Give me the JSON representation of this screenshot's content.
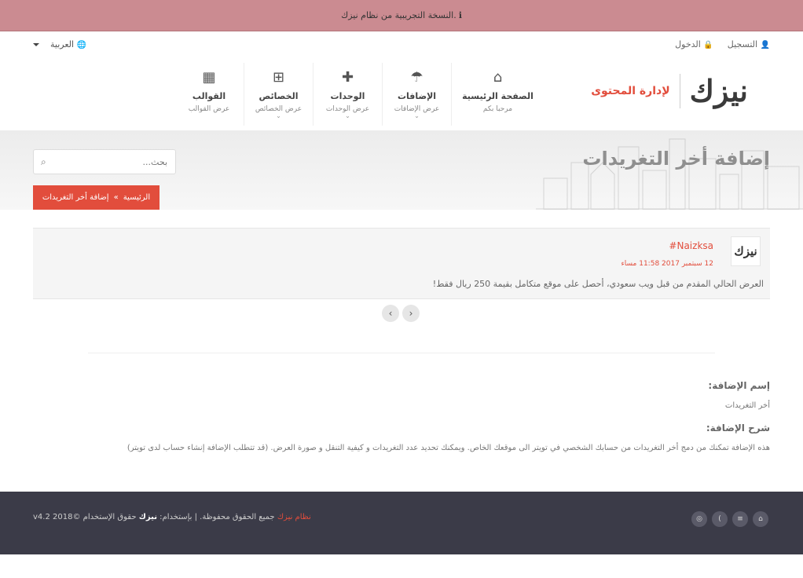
{
  "trial_bar": {
    "icon": "info-icon",
    "text": "النسخة التجريبية من نظام نيزك."
  },
  "topbar": {
    "register": "التسجيل",
    "login": "الدخول",
    "language": "العربية"
  },
  "logo": {
    "main": "نيزك",
    "sub": "لإدارة المحتوى"
  },
  "nav": [
    {
      "title": "الصفحة الرئيسية",
      "sub": "مرحبا بكم",
      "icon": "home-icon",
      "glyph": "⌂",
      "has_dropdown": false
    },
    {
      "title": "الإضافات",
      "sub": "عرض الإضافات",
      "icon": "umbrella-icon",
      "glyph": "☂",
      "has_dropdown": true
    },
    {
      "title": "الوحدات",
      "sub": "عرض الوحدات",
      "icon": "puzzle-icon",
      "glyph": "✚",
      "has_dropdown": true
    },
    {
      "title": "الخصائص",
      "sub": "عرض الخصائص",
      "icon": "sitemap-icon",
      "glyph": "⊞",
      "has_dropdown": true
    },
    {
      "title": "القوالب",
      "sub": "عرض القوالب",
      "icon": "qrcode-icon",
      "glyph": "▦",
      "has_dropdown": false
    }
  ],
  "banner": {
    "title": "إضافة أخر التغريدات",
    "search_placeholder": "بحث...",
    "breadcrumb_home": "الرئيسية",
    "breadcrumb_sep": "»",
    "breadcrumb_current": "إضافة أخر التغريدات"
  },
  "tweet": {
    "avatar": "نيزك",
    "user": "#Naizksa",
    "date": "12 سبتمبر 2017 11:58 مساء",
    "text": "العرض الحالي المقدم من قبل ويب سعودي، أحصل على موقع متكامل بقيمة 250 ريال فقط!"
  },
  "pager": {
    "prev": "‹",
    "next": "›"
  },
  "info": {
    "name_label": "إسم الإضافة:",
    "name_value": "أخر التغريدات",
    "desc_label": "شرح الإضافة:",
    "desc_value": "هذه الإضافة تمكنك من دمج أخر التغريدات من حسابك الشخصي في تويتر الى موقعك الخاص. ويمكنك تحديد عدد التغريدات و كيفية التنقل و صورة العرض. (قد تتطلب الإضافة إنشاء حساب لدى تويتر)"
  },
  "footer": {
    "prefix": "حقوق الإستخدام ©2018",
    "brand": "نيزك",
    "middle": "جميع الحقوق محفوظة. | بإستخدام:",
    "system": "نظام نيزك",
    "version": "v4.2",
    "socials": [
      {
        "icon": "home-icon",
        "glyph": "⌂"
      },
      {
        "icon": "html5-icon",
        "glyph": "≡"
      },
      {
        "icon": "rss-icon",
        "glyph": ")"
      },
      {
        "icon": "compass-icon",
        "glyph": "◎"
      }
    ]
  }
}
